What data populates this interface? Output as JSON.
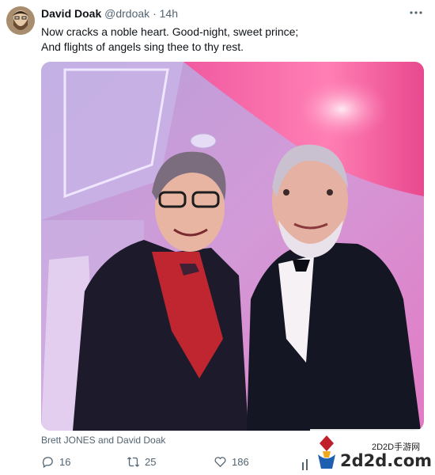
{
  "tweet": {
    "author_name": "David Doak",
    "handle": "@drdoak",
    "separator": "·",
    "time": "14h",
    "text_line1": "Now cracks a noble heart. Good-night, sweet prince;",
    "text_line2": "And flights of angels sing thee to thy rest.",
    "media_caption": "Brett JONES and David Doak"
  },
  "actions": {
    "replies": "16",
    "retweets": "25",
    "likes": "186"
  },
  "watermark": {
    "tag": "2D2D手游网",
    "brand": "2d2d.com"
  },
  "icons": {
    "more": "more-icon",
    "reply": "reply-icon",
    "retweet": "retweet-icon",
    "like": "heart-icon",
    "views": "views-icon"
  },
  "colors": {
    "text_primary": "#0f1419",
    "text_secondary": "#536471"
  }
}
